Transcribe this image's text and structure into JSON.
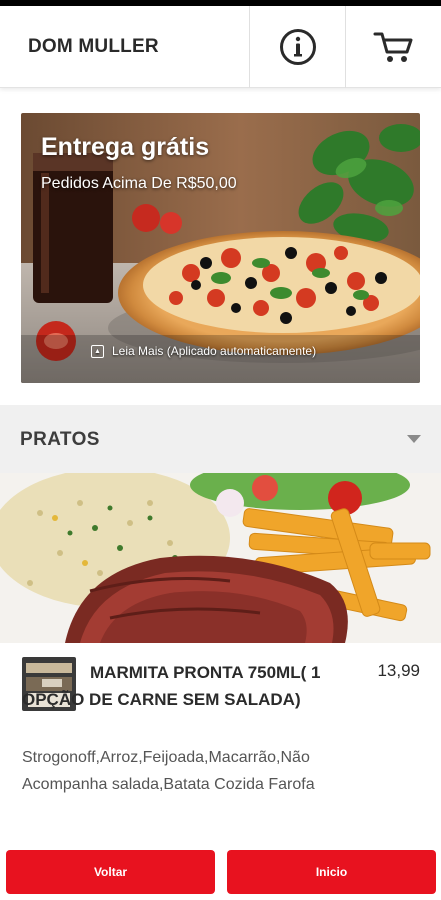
{
  "header": {
    "title": "DOM MULLER",
    "info_icon": "info-icon",
    "cart_icon": "cart-icon"
  },
  "banner": {
    "title": "Entrega grátis",
    "subtitle": "Pedidos Acima De R$50,00",
    "more": "Leia Mais (Aplicado automaticamente)"
  },
  "category": {
    "label": "PRATOS"
  },
  "item": {
    "name": "MARMITA PRONTA 750ML( 1 OPÇÃO DE CARNE SEM SALADA)",
    "price": "13,99",
    "description": "Strogonoff,Arroz,Feijoada,Macarrão,Não Acompanha salada,Batata Cozida Farofa"
  },
  "footer": {
    "back": "Voltar",
    "home": "Inicio"
  },
  "colors": {
    "accent": "#e8121f"
  }
}
